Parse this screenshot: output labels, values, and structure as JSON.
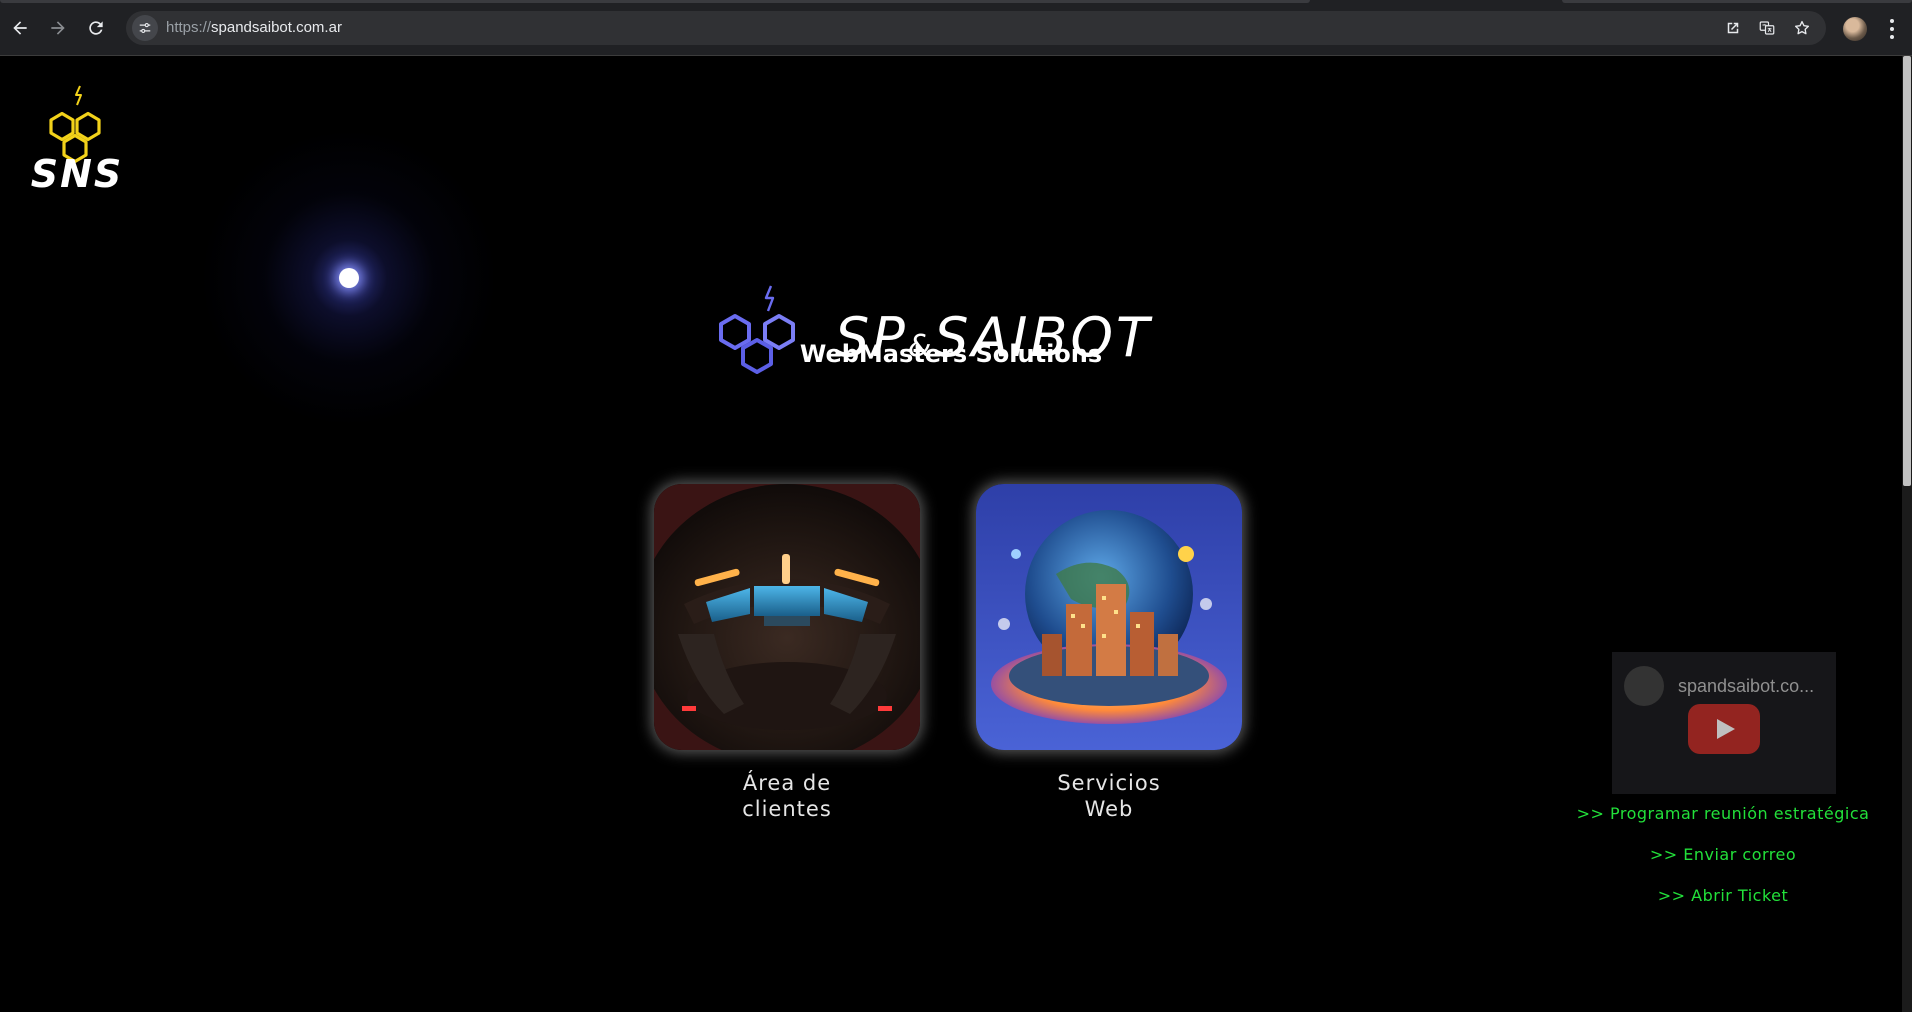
{
  "browser": {
    "url_scheme": "https://",
    "url_host": "spandsaibot.com.ar",
    "icons": [
      "back-icon",
      "forward-icon",
      "reload-icon",
      "site-settings-icon",
      "open-in-new-icon",
      "translate-icon",
      "bookmark-star-icon",
      "profile-avatar",
      "more-menu-icon"
    ]
  },
  "page": {
    "corner_logo_text": "SNS",
    "brand_name_left": "SP",
    "brand_amp": "&",
    "brand_name_right": "SAIBOT",
    "tagline": "WebMasters Solutions",
    "cards": [
      {
        "line1": "Área de",
        "line2": "clientes"
      },
      {
        "line1": "Servicios",
        "line2": "Web"
      }
    ],
    "video_channel_title": "spandsaibot.co...",
    "contact_links": [
      ">> Programar reunión estratégica",
      ">> Enviar correo",
      ">> Abrir Ticket"
    ],
    "colors": {
      "background": "#000000",
      "accent_green": "#22e03a",
      "logo_yellow": "#f2d21a",
      "brand_blue": "#6a6cf0"
    }
  }
}
